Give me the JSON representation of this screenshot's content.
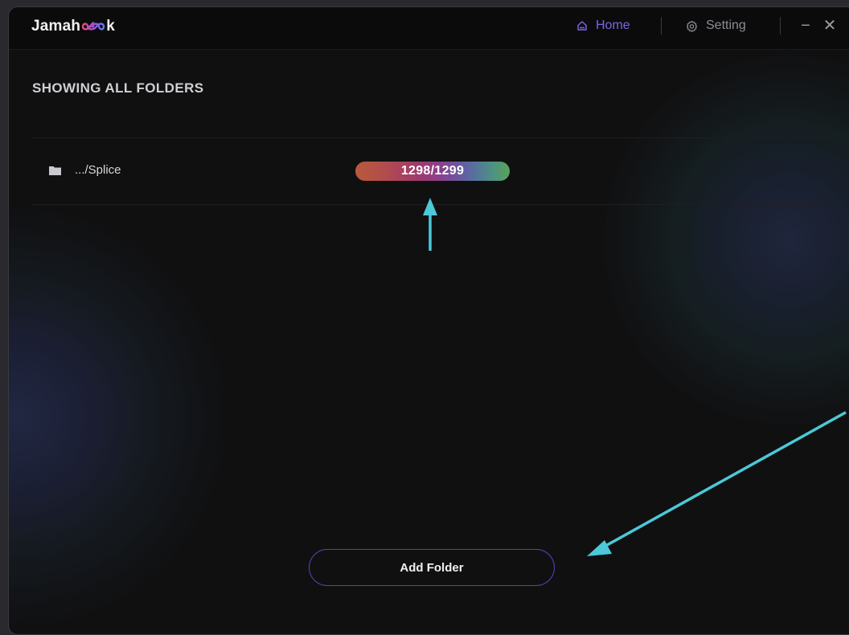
{
  "app": {
    "brand_prefix": "Jamah",
    "brand_suffix": "k",
    "logo_icon": "infinity-logo-icon"
  },
  "nav": {
    "home_label": "Home",
    "home_icon": "home-icon",
    "setting_label": "Setting",
    "setting_icon": "gear-icon",
    "minimize_glyph": "−",
    "close_glyph": "✕"
  },
  "main": {
    "section_title": "SHOWING ALL FOLDERS",
    "folders": [
      {
        "icon": "folder-icon",
        "name": ".../Splice",
        "processed": 1298,
        "total": 1299,
        "progress_text": "1298/1299"
      }
    ],
    "add_folder_label": "Add Folder"
  },
  "colors": {
    "accent": "#7f63e6",
    "button_border": "#5a3fb8",
    "annotation_arrow": "#4cc8d8"
  }
}
